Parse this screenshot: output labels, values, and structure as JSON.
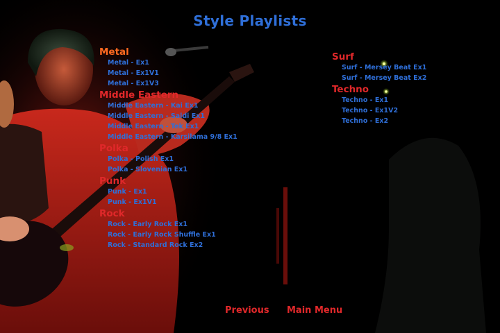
{
  "title": "Style Playlists",
  "colors": {
    "link_blue": "#2f6fd8",
    "heading_red": "#e0282a",
    "heading_orange": "#ff6a20",
    "background": "#000000"
  },
  "categories_left": [
    {
      "name": "Metal",
      "color": "#ff6a20",
      "items": [
        "Metal - Ex1",
        "Metal - Ex1V1",
        "Metal - Ex1V3"
      ]
    },
    {
      "name": "Middle Eastern",
      "color": "#e0282a",
      "items": [
        "Middle Eastern - Kai Ex1",
        "Middle Eastern - Saidi Ex1",
        "Middle Eastern - Tek Ex1",
        "Middle Eastern - Karsilama 9/8 Ex1"
      ]
    },
    {
      "name": "Polka",
      "color": "#e0282a",
      "items": [
        "Polka - Polish Ex1",
        "Polka - Slovenian Ex1"
      ]
    },
    {
      "name": "Punk",
      "color": "#e0282a",
      "items": [
        "Punk - Ex1",
        "Punk - Ex1V1"
      ]
    },
    {
      "name": "Rock",
      "color": "#e0282a",
      "items": [
        "Rock - Early Rock Ex1",
        "Rock - Early Rock Shuffle Ex1",
        "Rock - Standard Rock Ex2"
      ]
    }
  ],
  "categories_right": [
    {
      "name": "Surf",
      "color": "#e0282a",
      "items": [
        "Surf - Mersey Beat Ex1",
        "Surf - Mersey Beat Ex2"
      ]
    },
    {
      "name": "Techno",
      "color": "#e0282a",
      "items": [
        "Techno - Ex1",
        "Techno - Ex1V2",
        "Techno - Ex2"
      ]
    }
  ],
  "nav": {
    "previous": "Previous",
    "main_menu": "Main Menu"
  }
}
